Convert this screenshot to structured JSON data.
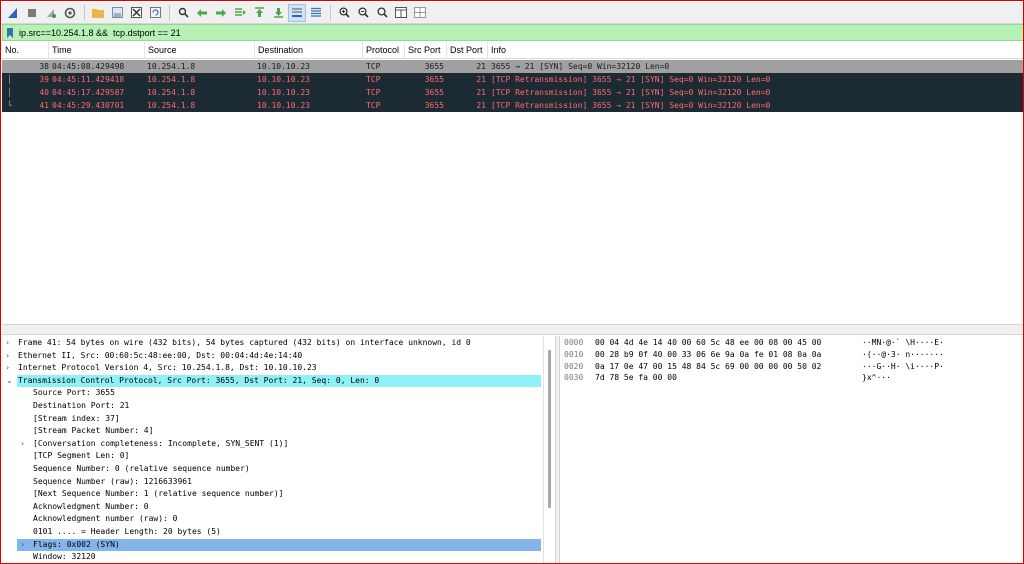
{
  "toolbar": {
    "icons": [
      "shark-fin-icon",
      "stop-icon",
      "restart-icon",
      "options-icon",
      "open-folder-icon",
      "save-icon",
      "close-file-icon",
      "reload-icon",
      "find-icon",
      "back-icon",
      "forward-icon",
      "goto-icon",
      "first-packet-icon",
      "last-packet-icon",
      "autoscroll-icon",
      "colorize-icon",
      "zoom-in-icon",
      "zoom-out-icon",
      "zoom-normal-icon",
      "resize-columns-icon",
      "expand-icon"
    ]
  },
  "filter": {
    "value": "ip.src==10.254.1.8 &&  tcp.dstport == 21"
  },
  "packet_list": {
    "columns": [
      "No.",
      "Time",
      "Source",
      "Destination",
      "Protocol",
      "Src Port",
      "Dst Port",
      "Info"
    ],
    "rows": [
      {
        "no": "38",
        "time": "04:45:08.429498",
        "source": "10.254.1.8",
        "destination": "10.10.10.23",
        "protocol": "TCP",
        "src_port": "3655",
        "dst_port": "21",
        "info": "3655 → 21 [SYN] Seq=0 Win=32120 Len=0",
        "style": "selected"
      },
      {
        "no": "39",
        "time": "04:45:11.429418",
        "source": "10.254.1.8",
        "destination": "10.10.10.23",
        "protocol": "TCP",
        "src_port": "3655",
        "dst_port": "21",
        "info": "[TCP Retransmission] 3655 → 21 [SYN] Seq=0 Win=32120 Len=0",
        "style": "error"
      },
      {
        "no": "40",
        "time": "04:45:17.429587",
        "source": "10.254.1.8",
        "destination": "10.10.10.23",
        "protocol": "TCP",
        "src_port": "3655",
        "dst_port": "21",
        "info": "[TCP Retransmission] 3655 → 21 [SYN] Seq=0 Win=32120 Len=0",
        "style": "error"
      },
      {
        "no": "41",
        "time": "04:45:29.430701",
        "source": "10.254.1.8",
        "destination": "10.10.10.23",
        "protocol": "TCP",
        "src_port": "3655",
        "dst_port": "21",
        "info": "[TCP Retransmission] 3655 → 21 [SYN] Seq=0 Win=32120 Len=0",
        "style": "error"
      }
    ]
  },
  "details": {
    "rows": [
      {
        "text": "Frame 41: 54 bytes on wire (432 bits), 54 bytes captured (432 bits) on interface unknown, id 0",
        "expander": "collapsed",
        "level": 0
      },
      {
        "text": "Ethernet II, Src: 00:60:5c:48:ee:00, Dst: 00:04:4d:4e:14:40",
        "expander": "collapsed",
        "level": 0
      },
      {
        "text": "Internet Protocol Version 4, Src: 10.254.1.8, Dst: 10.10.10.23",
        "expander": "collapsed",
        "level": 0
      },
      {
        "text": "Transmission Control Protocol, Src Port: 3655, Dst Port: 21, Seq: 0, Len: 0",
        "expander": "expanded",
        "level": 0,
        "highlight": "tcp"
      },
      {
        "text": "Source Port: 3655",
        "expander": "none",
        "level": 1
      },
      {
        "text": "Destination Port: 21",
        "expander": "none",
        "level": 1
      },
      {
        "text": "[Stream index: 37]",
        "expander": "none",
        "level": 1
      },
      {
        "text": "[Stream Packet Number: 4]",
        "expander": "none",
        "level": 1
      },
      {
        "text": "[Conversation completeness: Incomplete, SYN_SENT (1)]",
        "expander": "collapsed",
        "level": 1
      },
      {
        "text": "[TCP Segment Len: 0]",
        "expander": "none",
        "level": 1
      },
      {
        "text": "Sequence Number: 0    (relative sequence number)",
        "expander": "none",
        "level": 1
      },
      {
        "text": "Sequence Number (raw): 1216633961",
        "expander": "none",
        "level": 1
      },
      {
        "text": "[Next Sequence Number: 1    (relative sequence number)]",
        "expander": "none",
        "level": 1
      },
      {
        "text": "Acknowledgment Number: 0",
        "expander": "none",
        "level": 1
      },
      {
        "text": "Acknowledgment number (raw): 0",
        "expander": "none",
        "level": 1
      },
      {
        "text": "0101 .... = Header Length: 20 bytes (5)",
        "expander": "none",
        "level": 1
      },
      {
        "text": "Flags: 0x002 (SYN)",
        "expander": "collapsed",
        "level": 1,
        "highlight": "flags"
      },
      {
        "text": "Window: 32120",
        "expander": "none",
        "level": 1
      }
    ]
  },
  "bytes": {
    "rows": [
      {
        "offset": "0000",
        "hex": "00 04 4d 4e 14 40 00 60  5c 48 ee 00 08 00 45 00",
        "ascii": "··MN·@·` \\H····E·"
      },
      {
        "offset": "0010",
        "hex": "00 28 b9 0f 40 00 33 06  6e 9a 0a fe 01 08 0a 0a",
        "ascii": "·(··@·3· n·······"
      },
      {
        "offset": "0020",
        "hex": "0a 17 0e 47 00 15 48 84  5c 69 00 00 00 00 50 02",
        "ascii": "···G··H· \\i····P·"
      },
      {
        "offset": "0030",
        "hex": "7d 78 5e fa 00 00",
        "ascii": "}x^···"
      }
    ]
  },
  "colors": {
    "filter_bg": "#b6f2b6",
    "selected_row": "#a0a0a0",
    "error_row_bg": "#1c2a33",
    "error_row_fg": "#ff6b6b",
    "tcp_highlight": "#90f0f8",
    "flags_highlight": "#84b4ec"
  }
}
